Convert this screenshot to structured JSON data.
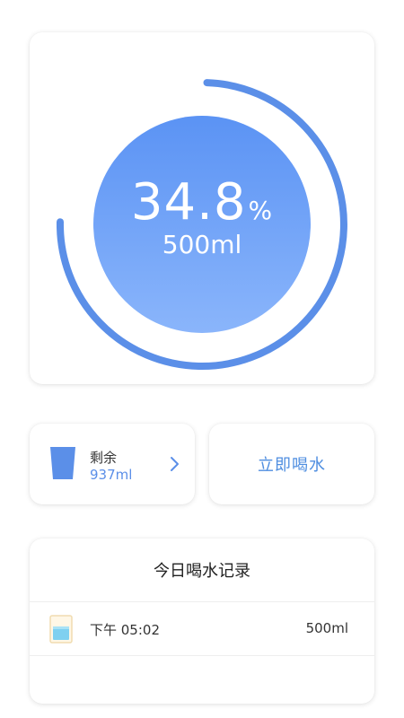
{
  "progress": {
    "percent_value": "34.8",
    "percent_sign": "%",
    "amount": "500ml",
    "fraction": 0.348,
    "colors": {
      "ring": "#5b8fe8",
      "circle_top": "#5b93f4",
      "circle_bottom": "#8ab5fb"
    }
  },
  "remaining": {
    "icon": "cup-icon",
    "label": "剩余",
    "value": "937ml",
    "chevron_icon": "chevron-right-icon"
  },
  "drink_now": {
    "label": "立即喝水"
  },
  "records": {
    "title": "今日喝水记录",
    "items": [
      {
        "icon": "water-glass-icon",
        "time": "下午 05:02",
        "amount": "500ml"
      }
    ]
  }
}
